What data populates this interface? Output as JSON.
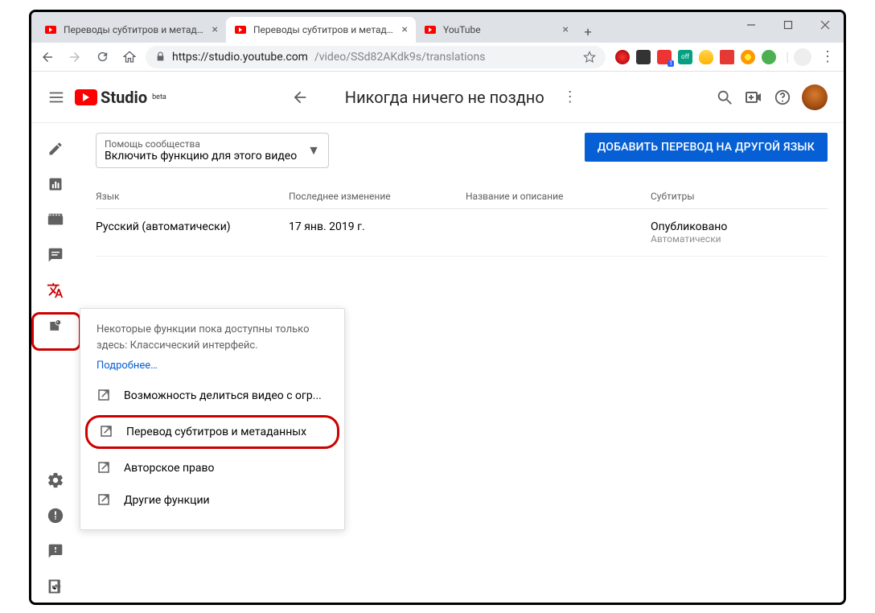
{
  "browser": {
    "tabs": [
      {
        "title": "Переводы субтитров и метадан"
      },
      {
        "title": "Переводы субтитров и метадан"
      },
      {
        "title": "YouTube"
      }
    ],
    "url_host": "https://studio.youtube.com",
    "url_path": "/video/SSd82AKdk9s/translations"
  },
  "header": {
    "logo_text": "Studio",
    "logo_sup": "beta",
    "title": "Никогда ничего не поздно"
  },
  "dropdown": {
    "label": "Помощь сообщества",
    "value": "Включить функцию для этого видео"
  },
  "primary_button": "ДОБАВИТЬ ПЕРЕВОД НА ДРУГОЙ ЯЗЫК",
  "table": {
    "headers": {
      "lang": "Язык",
      "modified": "Последнее изменение",
      "title_desc": "Название и описание",
      "subs": "Субтитры"
    },
    "row": {
      "lang": "Русский (автоматически)",
      "modified": "17 янв. 2019 г.",
      "title_desc": "",
      "subs": "Опубликовано",
      "subs2": "Автоматически"
    }
  },
  "popup": {
    "info": "Некоторые функции пока доступны только здесь: Классический интерфейс.",
    "link": "Подробнее…",
    "items": [
      "Возможность делиться видео с огр...",
      "Перевод субтитров и метаданных",
      "Авторское право",
      "Другие функции"
    ]
  }
}
